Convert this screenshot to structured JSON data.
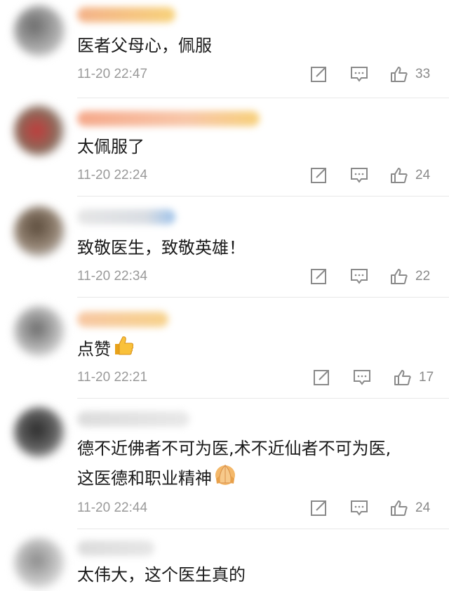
{
  "comments": [
    {
      "text": "医者父母心，佩服",
      "time": "11-20 22:47",
      "likes": "33",
      "emoji": ""
    },
    {
      "text": "太佩服了",
      "time": "11-20 22:24",
      "likes": "24",
      "emoji": ""
    },
    {
      "text": "致敬医生，致敬英雄！",
      "time": "11-20 22:34",
      "likes": "22",
      "emoji": ""
    },
    {
      "text": "点赞",
      "time": "11-20 22:21",
      "likes": "17",
      "emoji": "thumbs-up-icon"
    },
    {
      "text": "德不近佛者不可为医,术不近仙者不可为医,\n这医德和职业精神",
      "time": "11-20 22:44",
      "likes": "24",
      "emoji": "pray-hands-icon"
    },
    {
      "text": "太伟大，这个医生真的",
      "time": "",
      "likes": "",
      "emoji": ""
    }
  ],
  "icons": {
    "share": "share-icon",
    "reply": "comment-icon",
    "like": "thumbs-up-icon"
  },
  "colors": {
    "meta_text": "#9a9a9a",
    "icon_stroke": "#8a8a8a",
    "divider": "#e8e8e8"
  }
}
